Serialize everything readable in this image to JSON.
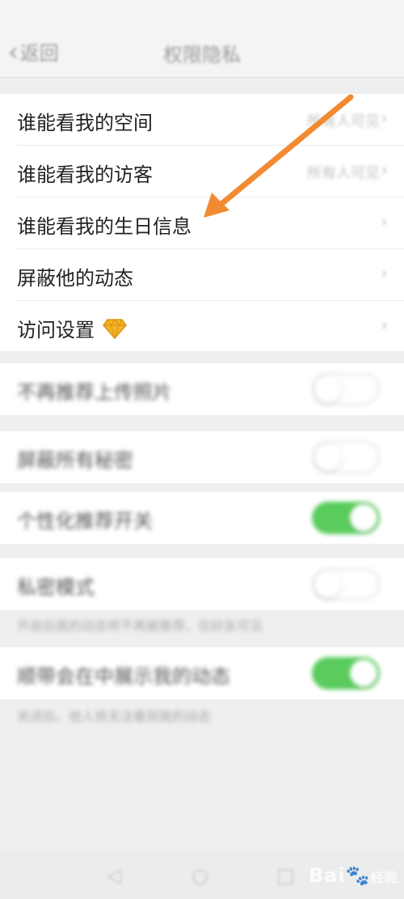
{
  "header": {
    "back_label": "返回",
    "title": "权限隐私"
  },
  "main_menu": [
    {
      "label": "谁能看我的空间",
      "value": "所有人可见"
    },
    {
      "label": "谁能看我的访客",
      "value": "所有人可见"
    },
    {
      "label": "谁能看我的生日信息",
      "value": ""
    },
    {
      "label": "屏蔽他的动态",
      "value": ""
    },
    {
      "label": "访问设置",
      "value": ""
    }
  ],
  "settings": [
    {
      "label": "不再推荐上传照片",
      "on": false
    },
    {
      "label": "屏蔽所有秘密",
      "on": false
    },
    {
      "label": "个性化推荐开关",
      "on": true
    },
    {
      "label": "私密模式",
      "on": false,
      "hint": "开启后我的动态将不再被推荐，仅好友可见"
    },
    {
      "label": "顺带会在中展示我的动态",
      "on": true,
      "hint": "关闭后，他人将无法看到我的动态"
    }
  ],
  "navbar": {
    "back_icon": "triangle-back-icon",
    "home_icon": "circle-home-icon",
    "recent_icon": "square-recent-icon"
  },
  "watermark": {
    "text": "Bai",
    "text2": "经验"
  },
  "colors": {
    "toggle_on": "#59cc5c",
    "arrow": "#f28a32",
    "gem": "#f4b424"
  }
}
